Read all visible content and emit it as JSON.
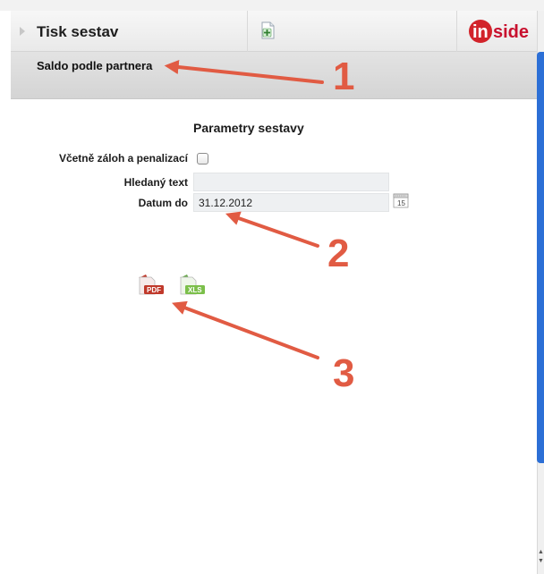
{
  "header": {
    "title": "Tisk sestav",
    "logo": {
      "text_a": "in",
      "text_b": "side",
      "brand_color": "#d2232a"
    }
  },
  "subheader": {
    "title": "Saldo podle partnera"
  },
  "form": {
    "section_title": "Parametry sestavy",
    "include_deposits_label": "Včetně záloh a penalizací",
    "include_deposits_checked": false,
    "search_label": "Hledaný text",
    "search_value": "",
    "date_label": "Datum do",
    "date_value": "31.12.2012",
    "calendar_icon_day": "15"
  },
  "exports": {
    "pdf_label": "PDF",
    "xls_label": "XLS"
  },
  "annotations": {
    "one": "1",
    "two": "2",
    "three": "3",
    "color": "#e15b43"
  },
  "icons": {
    "new": "add-document-icon",
    "calendar": "calendar-icon",
    "pdf": "pdf-export-icon",
    "xls": "xls-export-icon",
    "expand": "expand-triangle-icon"
  }
}
